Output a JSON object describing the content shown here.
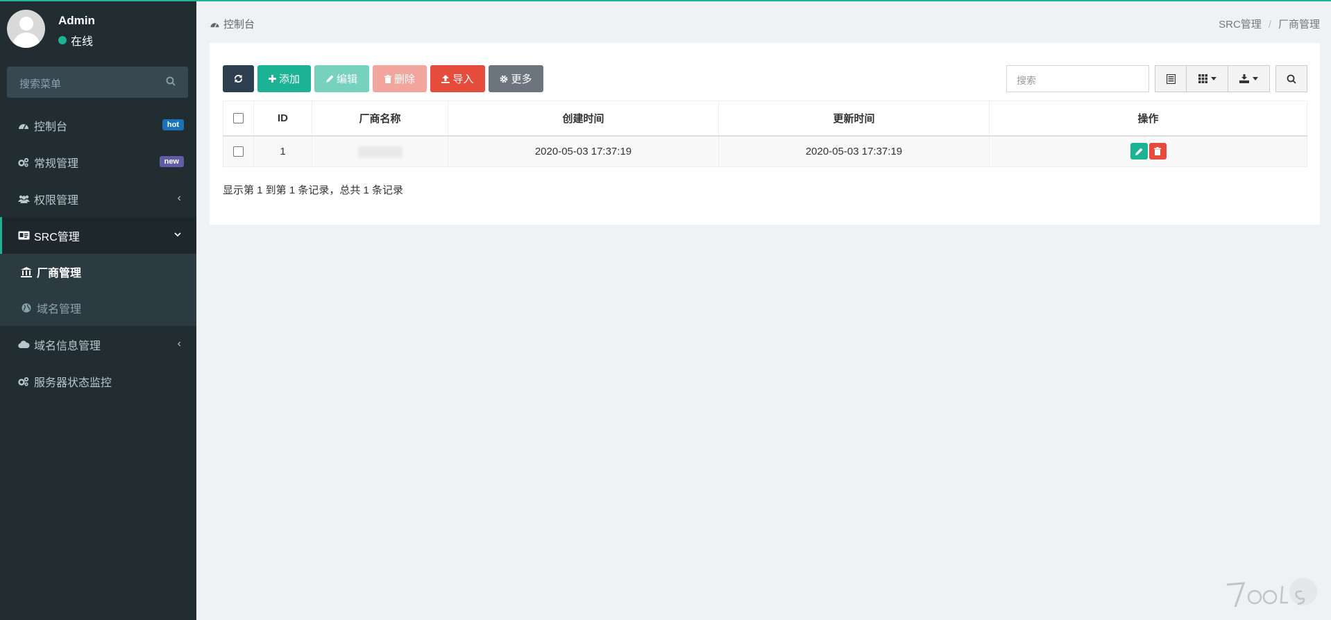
{
  "user": {
    "name": "Admin",
    "status": "在线"
  },
  "sidebar": {
    "search_placeholder": "搜索菜单",
    "items": [
      {
        "label": "控制台",
        "badge": "hot"
      },
      {
        "label": "常规管理",
        "badge": "new"
      },
      {
        "label": "权限管理"
      },
      {
        "label": "SRC管理"
      },
      {
        "label": "域名信息管理"
      },
      {
        "label": "服务器状态监控"
      }
    ],
    "sub_items": [
      {
        "label": "厂商管理"
      },
      {
        "label": "域名管理"
      }
    ]
  },
  "header": {
    "title": "控制台",
    "breadcrumb": [
      "SRC管理",
      "厂商管理"
    ]
  },
  "toolbar": {
    "add": "添加",
    "edit": "编辑",
    "delete": "删除",
    "import": "导入",
    "more": "更多",
    "search_placeholder": "搜索"
  },
  "table": {
    "columns": [
      "ID",
      "厂商名称",
      "创建时间",
      "更新时间",
      "操作"
    ],
    "rows": [
      {
        "id": "1",
        "name": "",
        "created": "2020-05-03 17:37:19",
        "updated": "2020-05-03 17:37:19"
      }
    ]
  },
  "pagination_info": "显示第 1 到第 1 条记录，总共 1 条记录",
  "colors": {
    "accent": "#1bb394",
    "sidebar_bg": "#222d32",
    "danger": "#e64c3c",
    "primary_dark": "#2c3e50"
  }
}
